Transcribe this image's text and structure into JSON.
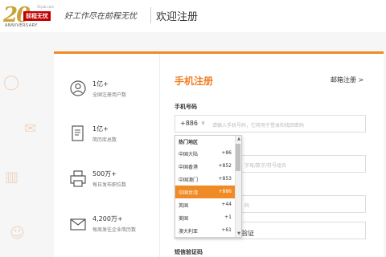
{
  "header": {
    "logo_number": "20",
    "logo_brand": "前程无忧",
    "logo_url": "51job.com",
    "logo_anniversary": "ANNIVERSARY",
    "slogan": "好工作尽在前程无忧",
    "title": "欢迎注册"
  },
  "stats": [
    {
      "icon": "user-icon",
      "value": "1亿+",
      "label": "全国注册用户数"
    },
    {
      "icon": "resume-icon",
      "value": "1亿+",
      "label": "简历库总数"
    },
    {
      "icon": "printer-icon",
      "value": "500万+",
      "label": "每日发布职位数"
    },
    {
      "icon": "mail-icon",
      "value": "4,200万+",
      "label": "每周发往企业简历数"
    }
  ],
  "form": {
    "title": "手机注册",
    "email_link": "邮箱注册 >",
    "phone_label": "手机号码",
    "country_code": "+886",
    "phone_placeholder": "请输入手机号码，它将用于登录和找回密码",
    "password_placeholder": "字母/数字/符号组合",
    "field3_placeholder": "码",
    "verify_text": "验证",
    "sms_label": "短信验证码"
  },
  "dropdown": {
    "header": "热门地区",
    "options": [
      {
        "name": "中国大陆",
        "code": "+86"
      },
      {
        "name": "中国香港",
        "code": "+852"
      },
      {
        "name": "中国澳门",
        "code": "+853"
      },
      {
        "name": "中国台湾",
        "code": "+886"
      },
      {
        "name": "英国",
        "code": "+44"
      },
      {
        "name": "美国",
        "code": "+1"
      },
      {
        "name": "澳大利亚",
        "code": "+61"
      }
    ],
    "selected_index": 3
  },
  "colors": {
    "accent": "#f08a24",
    "brand_red": "#c00000"
  }
}
